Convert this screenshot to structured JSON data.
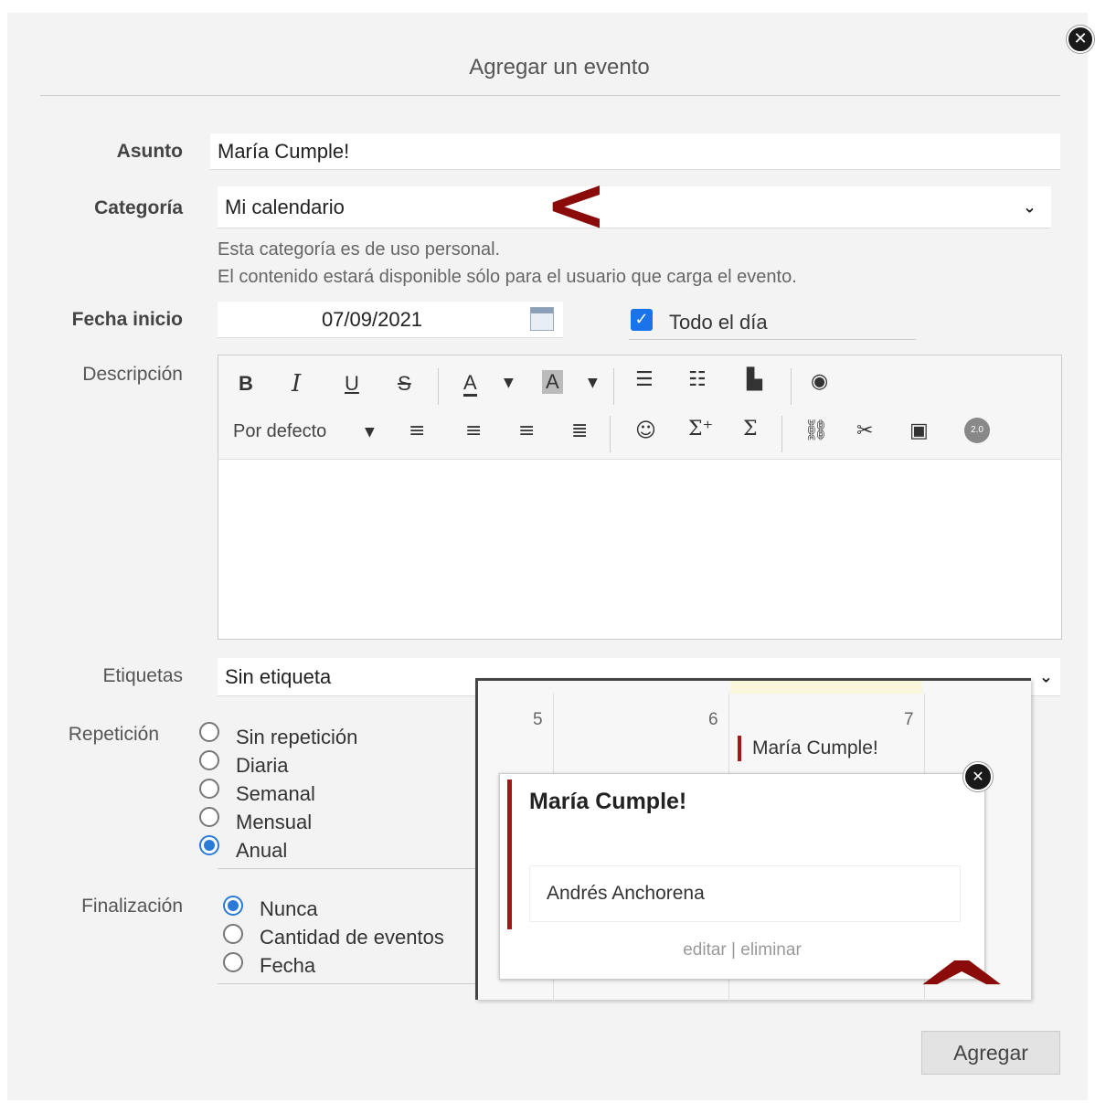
{
  "dialog": {
    "title": "Agregar un evento",
    "close_icon": "close-icon",
    "submit_label": "Agregar"
  },
  "form": {
    "asunto_label": "Asunto",
    "asunto_value": "María Cumple!",
    "categoria_label": "Categoría",
    "categoria_value": "Mi calendario",
    "categoria_hint_1": "Esta categoría es de uso personal.",
    "categoria_hint_2": "El contenido estará disponible sólo para el usuario que carga el evento.",
    "fecha_label": "Fecha inicio",
    "fecha_value": "07/09/2021",
    "todo_el_dia_label": "Todo el día",
    "todo_el_dia_checked": true,
    "descripcion_label": "Descripción",
    "etiquetas_label": "Etiquetas",
    "etiquetas_value": "Sin etiqueta",
    "repeticion_label": "Repetición",
    "repeticion_options": [
      "Sin repetición",
      "Diaria",
      "Semanal",
      "Mensual",
      "Anual"
    ],
    "repeticion_selected": "Anual",
    "finalizacion_label": "Finalización",
    "finalizacion_options": [
      "Nunca",
      "Cantidad de eventos",
      "Fecha"
    ],
    "finalizacion_selected": "Nunca"
  },
  "editor": {
    "toolbar_row1": [
      "B",
      "I",
      "U",
      "S",
      "A",
      "A"
    ],
    "font_style_label": "Por defecto"
  },
  "annotations": {
    "left_arrow": "<",
    "up_arrow": "^",
    "color": "#8b0a0a"
  },
  "calendar": {
    "day_numbers": [
      "5",
      "6",
      "7"
    ],
    "event_label": "María Cumple!",
    "event_color": "#a01818",
    "popup": {
      "title": "María Cumple!",
      "owner": "Andrés Anchorena",
      "edit_label": "editar",
      "separator": "|",
      "delete_label": "eliminar"
    }
  }
}
